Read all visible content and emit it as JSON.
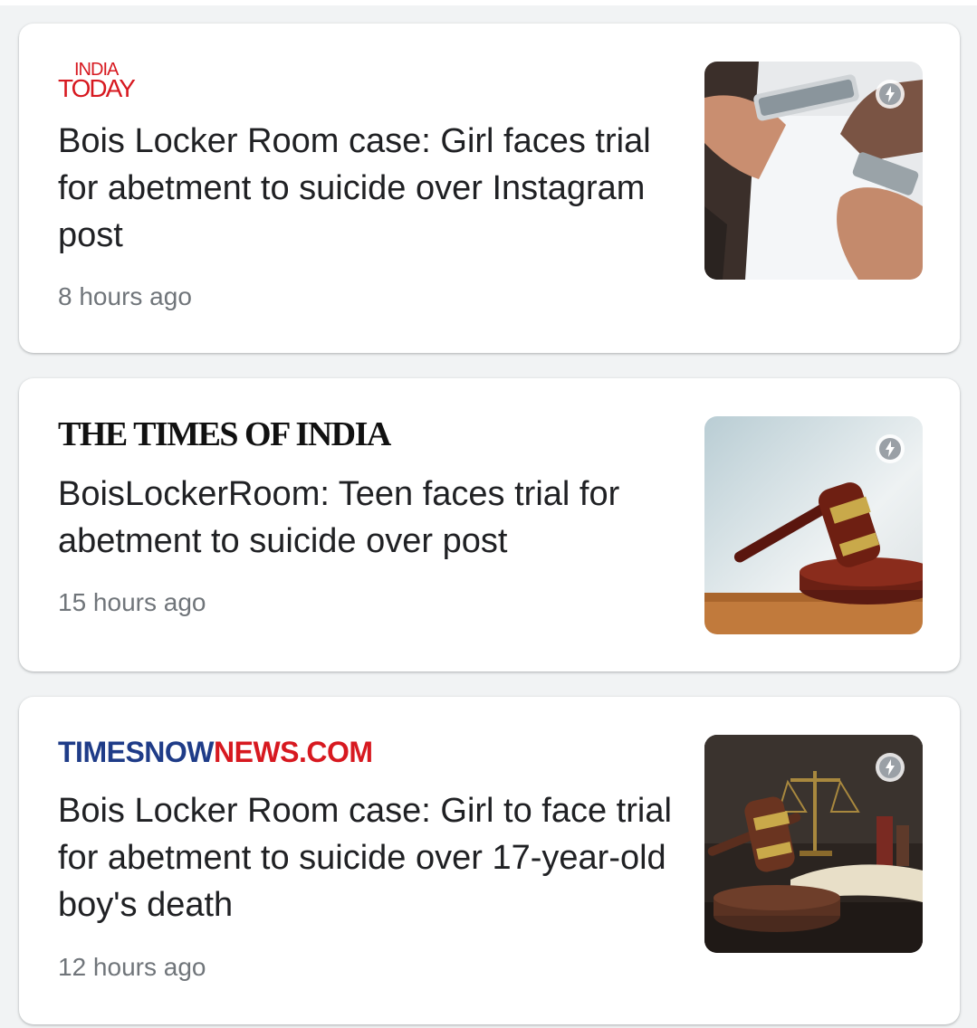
{
  "feed": {
    "articles": [
      {
        "source_logo_line1": "INDIA",
        "source_logo_line2": "TODAY",
        "headline": "Bois Locker Room case: Girl faces trial for abetment to suicide over Instagram post",
        "time": "8 hours ago",
        "thumbnail_icon": "hands-with-phones-photo",
        "badge_icon": "amp-lightning-icon",
        "brand_color": "#d71920"
      },
      {
        "source_logo": "THE TIMES OF INDIA",
        "headline": "BoisLockerRoom: Teen faces trial for abetment to suicide over post",
        "time": "15 hours ago",
        "thumbnail_icon": "gavel-photo",
        "badge_icon": "amp-lightning-icon",
        "brand_color": "#111111"
      },
      {
        "source_logo_part1": "TIMESNOW",
        "source_logo_part2": "NEWS.COM",
        "headline": "Bois Locker Room case: Girl to face trial for abetment to suicide over 17-year-old boy's death",
        "time": "12 hours ago",
        "thumbnail_icon": "gavel-scales-photo",
        "badge_icon": "amp-lightning-icon",
        "brand_color_primary": "#1f3c88",
        "brand_color_secondary": "#d71920"
      }
    ]
  },
  "colors": {
    "background": "#f1f3f4",
    "card": "#ffffff",
    "headline_text": "#202124",
    "timestamp_text": "#70757a"
  }
}
